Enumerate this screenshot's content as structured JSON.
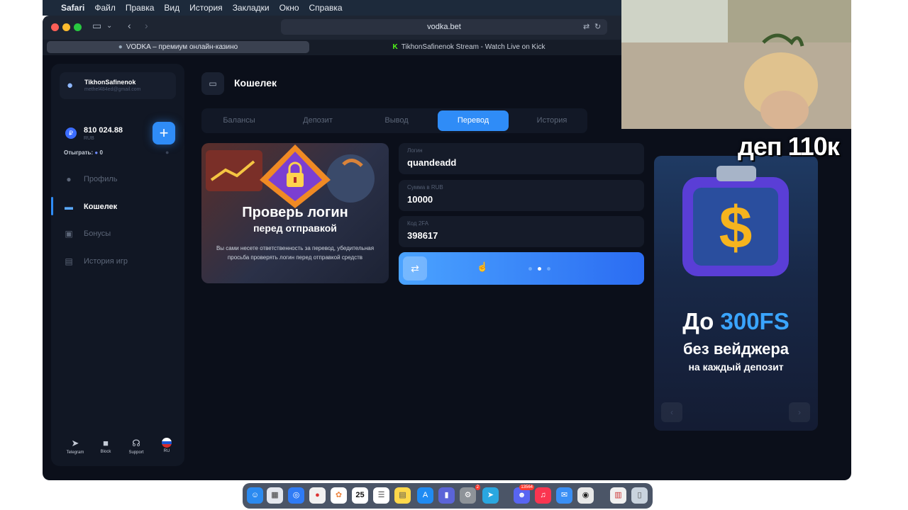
{
  "menubar": {
    "apple_icon": "apple-icon",
    "items": [
      "Safari",
      "Файл",
      "Правка",
      "Вид",
      "История",
      "Закладки",
      "Окно",
      "Справка"
    ]
  },
  "browser": {
    "url": "vodka.bet",
    "tabs": [
      {
        "title": "VODKA – премиум онлайн-казино",
        "active": true
      },
      {
        "title": "TikhonSafinenok Stream - Watch Live on Kick",
        "active": false
      }
    ]
  },
  "sidebar": {
    "username": "TikhonSafinenok",
    "email": "methel484ed@gmail.com",
    "balance": "810 024.88",
    "currency": "RUB",
    "add_label": "+",
    "wager_label": "Отыграть:",
    "wager_value": "0",
    "nav": [
      {
        "label": "Профиль",
        "icon": "profile-icon",
        "active": false
      },
      {
        "label": "Кошелек",
        "icon": "wallet-icon",
        "active": true
      },
      {
        "label": "Бонусы",
        "icon": "bonus-icon",
        "active": false
      },
      {
        "label": "История игр",
        "icon": "history-icon",
        "active": false
      }
    ],
    "bottom": [
      {
        "label": "Telegram",
        "icon": "telegram-icon"
      },
      {
        "label": "Block",
        "icon": "lock-icon"
      },
      {
        "label": "Support",
        "icon": "support-icon"
      },
      {
        "label": "RU",
        "icon": "russia-flag-icon"
      }
    ]
  },
  "main": {
    "title": "Кошелек",
    "tabs": [
      {
        "label": "Балансы",
        "active": false
      },
      {
        "label": "Депозит",
        "active": false
      },
      {
        "label": "Вывод",
        "active": false
      },
      {
        "label": "Перевод",
        "active": true
      },
      {
        "label": "История",
        "active": false
      }
    ],
    "promo": {
      "title": "Проверь логин",
      "subtitle": "перед отправкой",
      "description": "Вы сами несете ответственность за перевод, убедительная просьба проверять логин перед отправкой средств"
    },
    "form": {
      "login_label": "Логин",
      "login_value": "quandeadd",
      "amount_label": "Сумма в RUB",
      "amount_value": "10000",
      "twofa_label": "Код 2FA",
      "twofa_value": "398617",
      "submit_loading": true
    }
  },
  "banner": {
    "line1_prefix": "До",
    "line1_accent": "300FS",
    "line2": "без вейджера",
    "line3": "на каждый депозит"
  },
  "overlay": {
    "text": "деп 110к"
  },
  "dock": {
    "calendar_day": "25",
    "telegram_badge": "2",
    "discord_badge": "13564"
  },
  "colors": {
    "accent": "#2f8cf7",
    "background": "#0b0f1a",
    "panel": "#111724"
  }
}
